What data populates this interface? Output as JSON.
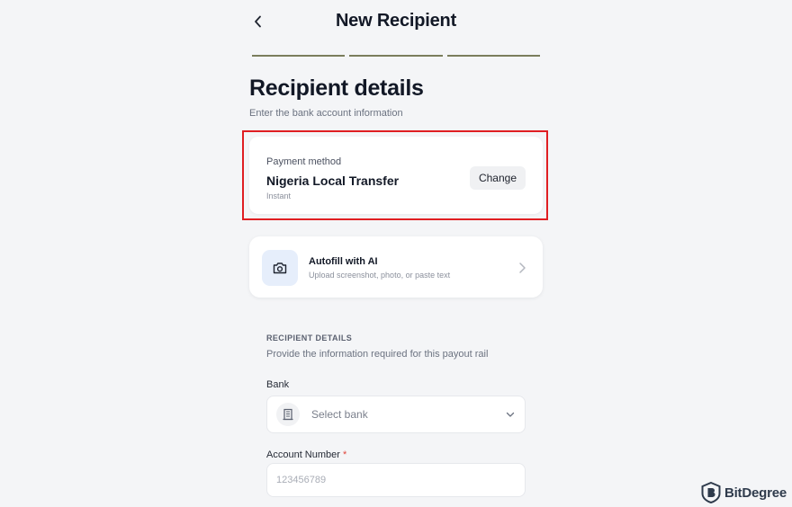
{
  "header": {
    "title": "New Recipient",
    "back_icon": "chevron-left-icon",
    "steps": 3
  },
  "intro": {
    "heading": "Recipient details",
    "subtitle": "Enter the bank account information"
  },
  "payment": {
    "label": "Payment method",
    "method": "Nigeria Local Transfer",
    "speed": "Instant",
    "change_label": "Change",
    "highlight_color": "#e01e22"
  },
  "autofill": {
    "title": "Autofill with AI",
    "subtitle": "Upload screenshot, photo, or paste text",
    "icon": "camera-icon"
  },
  "details": {
    "heading": "RECIPIENT DETAILS",
    "subtitle": "Provide the information required for this payout rail",
    "bank_label": "Bank",
    "bank_placeholder": "Select bank",
    "account_label": "Account Number",
    "required_mark": "*",
    "account_placeholder": "123456789"
  },
  "watermark": {
    "text": "BitDegree"
  },
  "colors": {
    "background": "#f4f5f7",
    "card": "#ffffff",
    "step_bar": "#7a7d5c",
    "autofill_icon_bg": "#e6eefb",
    "required": "#e0463c"
  }
}
